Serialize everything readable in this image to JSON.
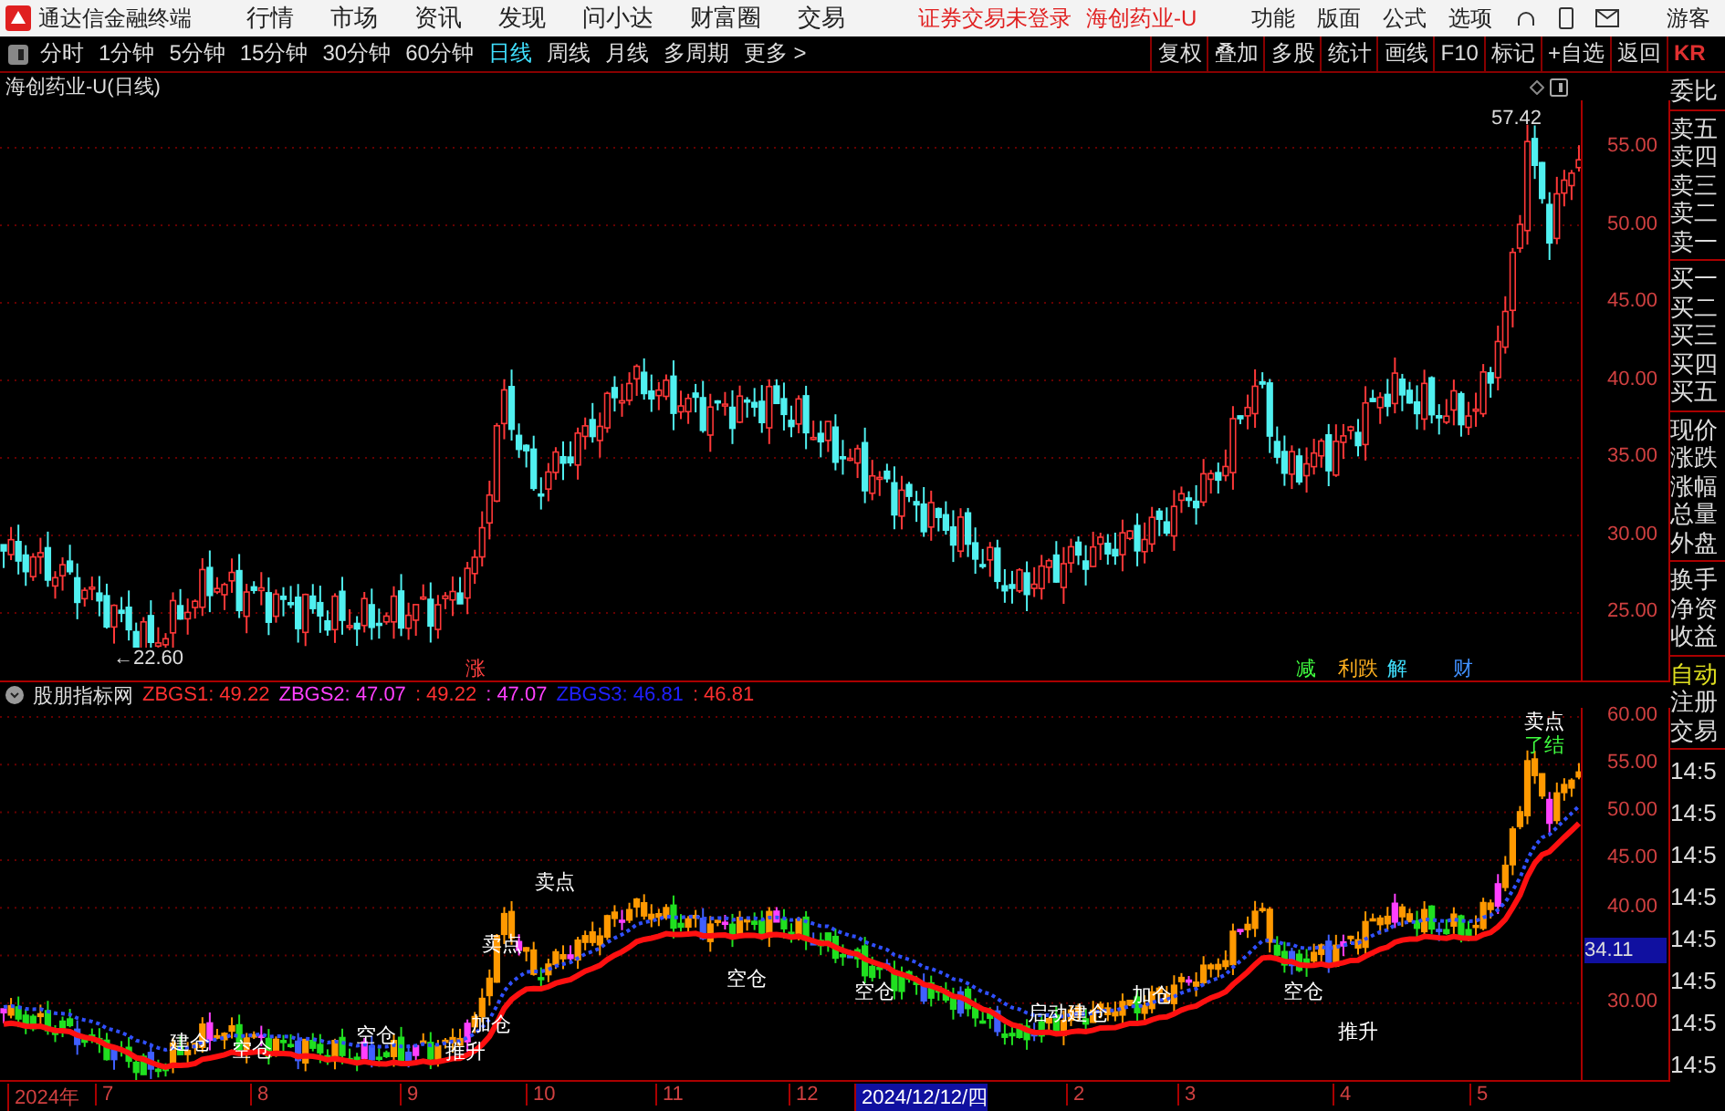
{
  "menu_bar": {
    "app_title": "通达信金融终端",
    "items": [
      "行情",
      "市场",
      "资讯",
      "发现",
      "问小达",
      "财富圈",
      "交易"
    ],
    "login_status": "证券交易未登录",
    "stock": "海创药业-U",
    "tools": [
      "功能",
      "版面",
      "公式",
      "选项"
    ],
    "user": "游客"
  },
  "period_bar": {
    "periods": [
      {
        "label": "分时",
        "selected": false
      },
      {
        "label": "1分钟",
        "selected": false
      },
      {
        "label": "5分钟",
        "selected": false
      },
      {
        "label": "15分钟",
        "selected": false
      },
      {
        "label": "30分钟",
        "selected": false
      },
      {
        "label": "60分钟",
        "selected": false
      },
      {
        "label": "日线",
        "selected": true
      },
      {
        "label": "周线",
        "selected": false
      },
      {
        "label": "月线",
        "selected": false
      },
      {
        "label": "多周期",
        "selected": false
      }
    ],
    "more": "更多 >",
    "actions": [
      "复权",
      "叠加",
      "多股",
      "统计",
      "画线",
      "F10",
      "标记",
      "+自选",
      "返回"
    ],
    "panel_tab": "KR"
  },
  "price_chart": {
    "title": "海创药业-U(日线)",
    "high_label": "57.42",
    "low_label": "←22.60",
    "axis_labels": [
      "55.00",
      "50.00",
      "45.00",
      "40.00",
      "35.00",
      "30.00",
      "25.00"
    ],
    "event_marks": [
      {
        "label": "涨",
        "color": "#ff4040"
      },
      {
        "label": "减",
        "color": "#40ff40"
      },
      {
        "label": "利跌",
        "color": "#ffb020"
      },
      {
        "label": "解",
        "color": "#40e0ff"
      },
      {
        "label": "财",
        "color": "#4090ff"
      }
    ]
  },
  "indicator": {
    "name": "股朋指标网",
    "values": [
      {
        "text": "ZBGS1: 49.22",
        "color": "#ff3030"
      },
      {
        "text": "ZBGS2: 47.07",
        "color": "#ff40ff"
      },
      {
        "text": ": 49.22",
        "color": "#ff3030"
      },
      {
        "text": ": 47.07",
        "color": "#ff40ff"
      },
      {
        "text": "ZBGS3: 46.81",
        "color": "#2020ff"
      },
      {
        "text": ": 46.81",
        "color": "#ff3030"
      }
    ],
    "axis_labels": [
      "60.00",
      "55.00",
      "50.00",
      "45.00",
      "40.00",
      "30.00"
    ],
    "current_price": "34.11",
    "signals": [
      {
        "label": "建仓",
        "color": "#ffffff"
      },
      {
        "label": "空仓",
        "color": "#ffffff"
      },
      {
        "label": "空仓",
        "color": "#ffffff"
      },
      {
        "label": "推升",
        "color": "#ffffff"
      },
      {
        "label": "加仓",
        "color": "#ffffff"
      },
      {
        "label": "卖点",
        "color": "#ffffff"
      },
      {
        "label": "卖点",
        "color": "#ffffff"
      },
      {
        "label": "空仓",
        "color": "#ffffff"
      },
      {
        "label": "空仓",
        "color": "#ffffff"
      },
      {
        "label": "启动建仓",
        "color": "#ffffff"
      },
      {
        "label": "加仓",
        "color": "#ffffff"
      },
      {
        "label": "空仓",
        "color": "#ffffff"
      },
      {
        "label": "推升",
        "color": "#ffffff"
      },
      {
        "label": "卖点",
        "color": "#ffffff"
      },
      {
        "label": "了结",
        "color": "#40ff40"
      }
    ]
  },
  "date_axis": [
    {
      "label": "2024年",
      "selected": false
    },
    {
      "label": "7",
      "selected": false
    },
    {
      "label": "8",
      "selected": false
    },
    {
      "label": "9",
      "selected": false
    },
    {
      "label": "10",
      "selected": false
    },
    {
      "label": "11",
      "selected": false
    },
    {
      "label": "12",
      "selected": false
    },
    {
      "label": "2024/12/12/四",
      "selected": true
    },
    {
      "label": "2",
      "selected": false
    },
    {
      "label": "3",
      "selected": false
    },
    {
      "label": "4",
      "selected": false
    },
    {
      "label": "5",
      "selected": false
    }
  ],
  "quote_panel": {
    "groups": [
      [
        "委比"
      ],
      [
        "卖五",
        "卖四",
        "卖三",
        "卖二",
        "卖一"
      ],
      [
        "买一",
        "买二",
        "买三",
        "买四",
        "买五"
      ],
      [
        "现价",
        "涨跌",
        "涨幅",
        "总量",
        "外盘"
      ],
      [
        "换手",
        "净资",
        "收益"
      ]
    ],
    "trade_items": [
      {
        "label": "自动",
        "highlighted": true
      },
      {
        "label": "注册",
        "highlighted": false
      },
      {
        "label": "交易",
        "highlighted": false
      }
    ],
    "times": [
      "14:5",
      "14:5",
      "14:5",
      "14:5",
      "14:5",
      "14:5",
      "14:5",
      "14:5"
    ]
  }
}
